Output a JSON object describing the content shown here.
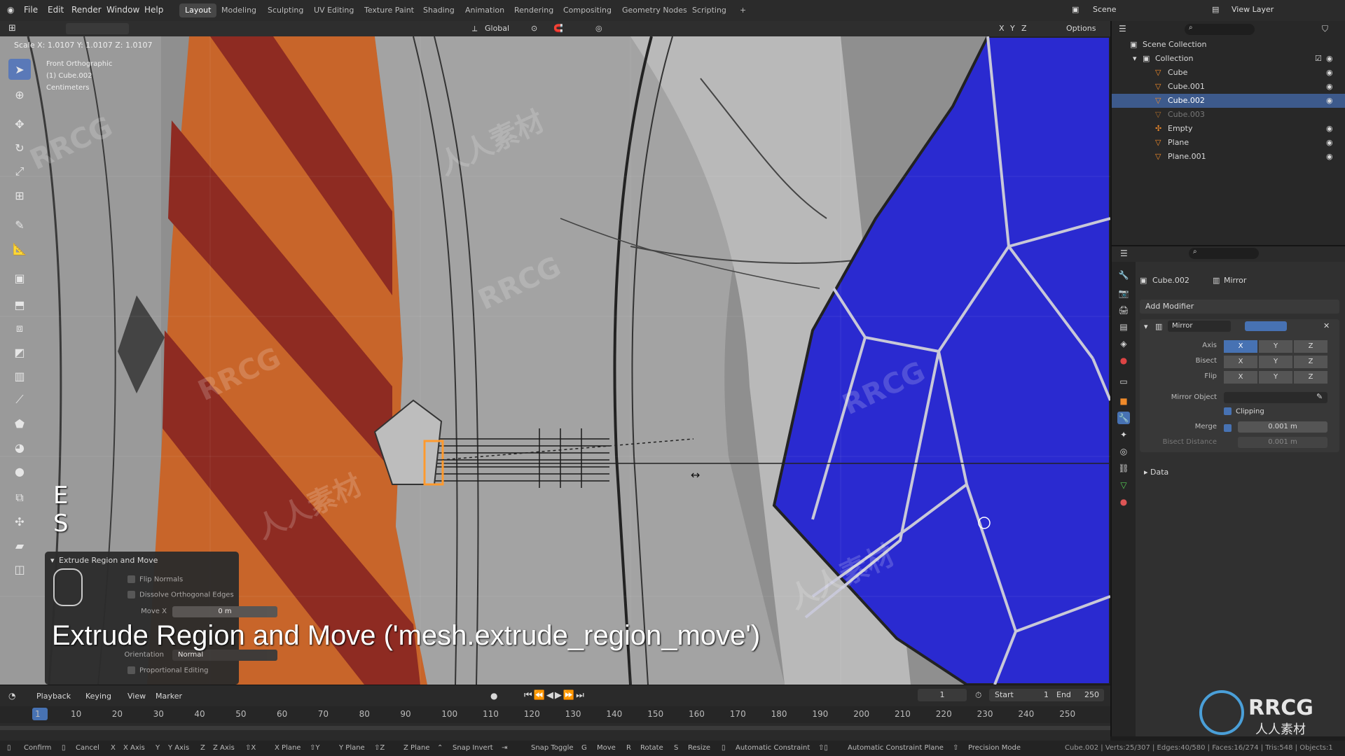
{
  "menu": {
    "file": "File",
    "edit": "Edit",
    "render": "Render",
    "window": "Window",
    "help": "Help"
  },
  "workspaces": [
    "Layout",
    "Modeling",
    "Sculpting",
    "UV Editing",
    "Texture Paint",
    "Shading",
    "Animation",
    "Rendering",
    "Compositing",
    "Geometry Nodes",
    "Scripting"
  ],
  "scene_label": "Scene",
  "view_layer_label": "View Layer",
  "header": {
    "orientation": "Global",
    "options": "Options",
    "axes": [
      "X",
      "Y",
      "Z"
    ]
  },
  "viewport": {
    "scale_readout": "Scale X: 1.0107   Y: 1.0107   Z: 1.0107",
    "view_name": "Front Orthographic",
    "object_name": "(1) Cube.002",
    "units": "Centimeters",
    "key_overlay_1": "E",
    "key_overlay_2": "S"
  },
  "outliner": {
    "root": "Scene Collection",
    "collection": "Collection",
    "items": [
      {
        "name": "Cube"
      },
      {
        "name": "Cube.001"
      },
      {
        "name": "Cube.002"
      },
      {
        "name": "Cube.003"
      },
      {
        "name": "Empty"
      },
      {
        "name": "Plane"
      },
      {
        "name": "Plane.001"
      }
    ]
  },
  "properties": {
    "object": "Cube.002",
    "modifier_tab": "Mirror",
    "add_modifier": "Add Modifier",
    "modifier_name": "Mirror",
    "axis_label": "Axis",
    "bisect_label": "Bisect",
    "flip_label": "Flip",
    "axis_buttons": [
      "X",
      "Y",
      "Z"
    ],
    "mirror_object_label": "Mirror Object",
    "clipping_label": "Clipping",
    "merge_label": "Merge",
    "merge_value": "0.001 m",
    "bisect_distance_label": "Bisect Distance",
    "bisect_distance_value": "0.001 m",
    "data_label": "Data"
  },
  "operator_panel": {
    "title": "Extrude Region and Move",
    "flip_normals": "Flip Normals",
    "dissolve": "Dissolve Orthogonal Edges",
    "move_x_label": "Move X",
    "move_x_value": "0 m",
    "orientation_label": "Orientation",
    "orientation_value": "Normal",
    "proportional": "Proportional Editing"
  },
  "caption": "Extrude Region and Move ('mesh.extrude_region_move')",
  "timeline": {
    "playback": "Playback",
    "keying": "Keying",
    "view": "View",
    "marker": "Marker",
    "current_frame": "1",
    "start_label": "Start",
    "start": "1",
    "end_label": "End",
    "end": "250",
    "ticks": [
      "1",
      "10",
      "20",
      "30",
      "40",
      "50",
      "60",
      "70",
      "80",
      "90",
      "100",
      "110",
      "120",
      "130",
      "140",
      "150",
      "160",
      "170",
      "180",
      "190",
      "200",
      "210",
      "220",
      "230",
      "240",
      "250"
    ]
  },
  "statusbar": {
    "confirm": "Confirm",
    "cancel": "Cancel",
    "x_axis": "X Axis",
    "y_axis": "Y Axis",
    "z_axis": "Z Axis",
    "x_plane": "X Plane",
    "y_plane": "Y Plane",
    "z_plane": "Z Plane",
    "snap_invert": "Snap Invert",
    "snap_toggle": "Snap Toggle",
    "move": "Move",
    "rotate": "Rotate",
    "resize": "Resize",
    "auto_constraint": "Automatic Constraint",
    "auto_constraint_plane": "Automatic Constraint Plane",
    "precision": "Precision Mode",
    "stats": "Cube.002 | Verts:25/307 | Edges:40/580 | Faces:16/274 | Tris:548 | Objects:1"
  },
  "watermarks": {
    "brand": "RRCG",
    "brand_cn": "人人素材"
  },
  "colors": {
    "accent": "#4772b3",
    "selection": "#ff9a2e",
    "crystal": "#2a2ad0",
    "stripe_red": "#8e2b22",
    "stripe_orange": "#c8652a"
  }
}
